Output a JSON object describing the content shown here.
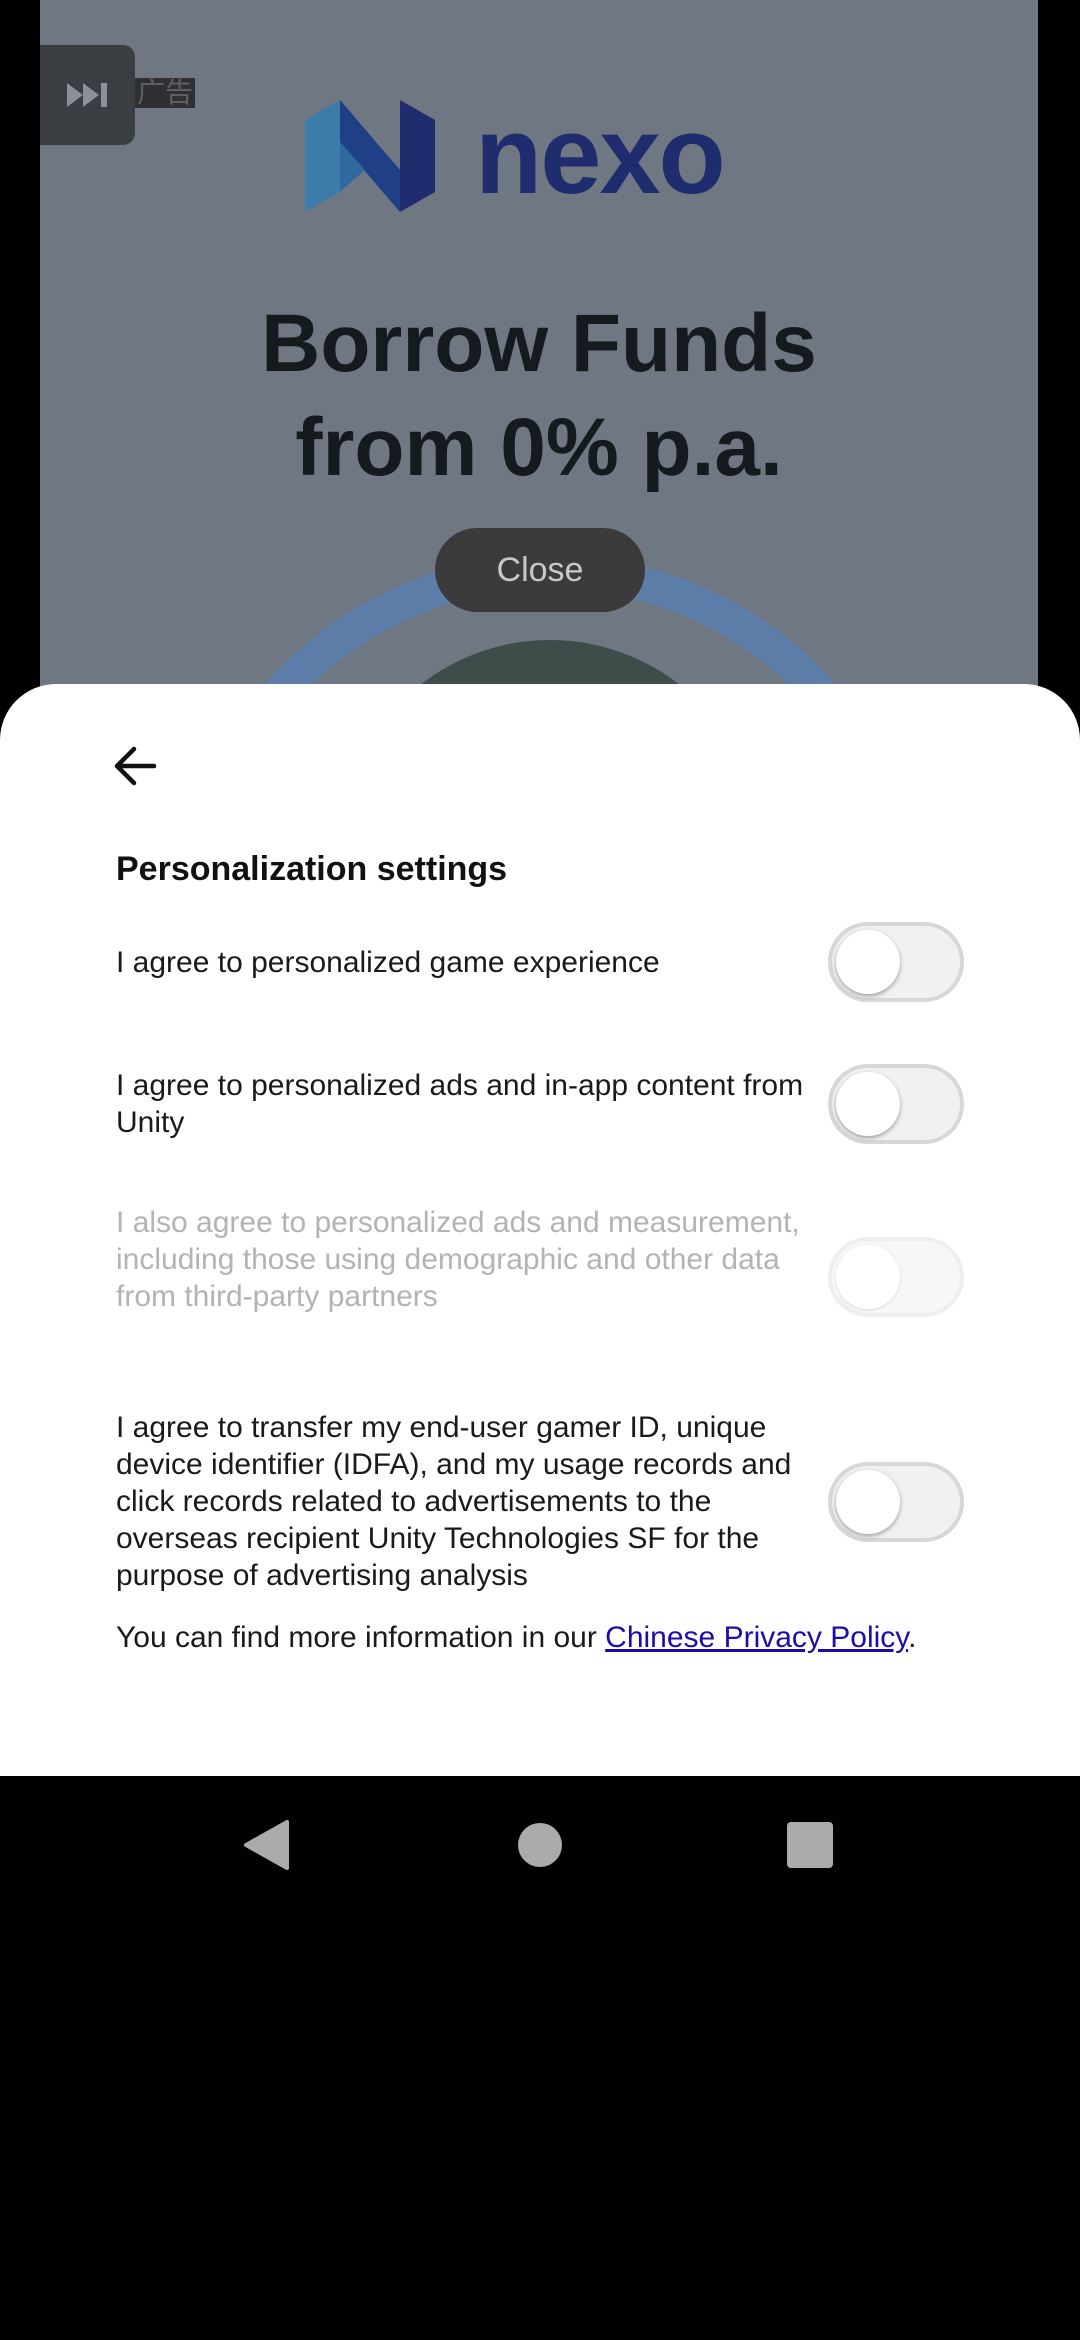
{
  "ad": {
    "brand": "nexo",
    "headline_line1": "Borrow Funds",
    "headline_line2": "from 0% p.a.",
    "ad_label": "广告",
    "close_label": "Close"
  },
  "sheet": {
    "title": "Personalization settings",
    "rows": [
      {
        "text": "I agree to personalized game experience",
        "on": false,
        "enabled": true
      },
      {
        "text": "I agree to personalized ads and in-app content from Unity",
        "on": false,
        "enabled": true
      },
      {
        "text": "I also agree to personalized ads and measurement, including those using demographic and other data from third-party partners",
        "on": false,
        "enabled": false
      },
      {
        "text": "I agree to transfer my end-user gamer ID, unique device identifier (IDFA), and my usage records and click records related to advertisements to the overseas recipient Unity Technologies SF for the purpose of advertising analysis",
        "on": false,
        "enabled": true
      }
    ],
    "info_prefix": "You can find more information in our ",
    "info_link": "Chinese Privacy Policy",
    "info_suffix": "."
  },
  "colors": {
    "link": "#1a0dab",
    "ad_background": "#6f7882",
    "brand": "#1f2c6e"
  },
  "nav": {
    "back_icon": "back-triangle-icon",
    "home_icon": "home-circle-icon",
    "recents_icon": "recents-square-icon"
  }
}
